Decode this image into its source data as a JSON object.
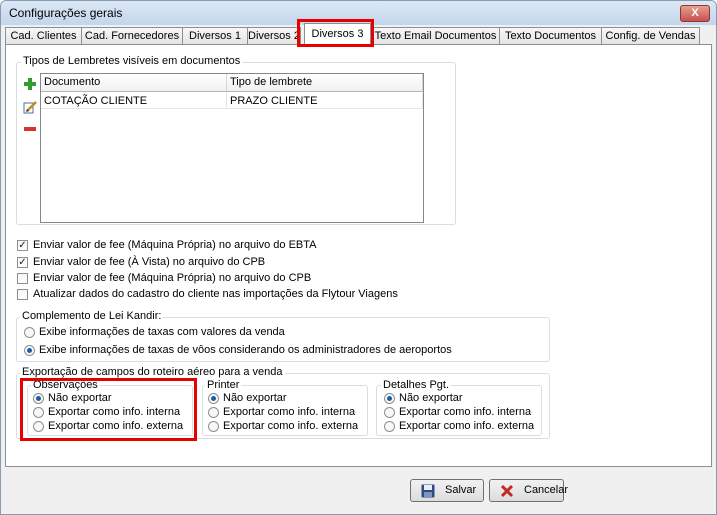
{
  "window": {
    "title": "Configurações gerais",
    "close_label": "X"
  },
  "tabs": [
    {
      "label": "Cad. Clientes"
    },
    {
      "label": "Cad. Fornecedores"
    },
    {
      "label": "Diversos 1"
    },
    {
      "label": "Diversos 2"
    },
    {
      "label": "Diversos 3",
      "active": true
    },
    {
      "label": "Texto Email Documentos"
    },
    {
      "label": "Texto Documentos"
    },
    {
      "label": "Config. de Vendas"
    }
  ],
  "reminders": {
    "group_label": "Tipos de Lembretes visíveis em documentos",
    "columns": [
      "Documento",
      "Tipo de lembrete"
    ],
    "rows": [
      {
        "documento": "COTAÇÃO CLIENTE",
        "tipo": "PRAZO CLIENTE"
      }
    ],
    "icons": [
      "add-icon",
      "edit-icon",
      "remove-icon"
    ]
  },
  "checkboxes": [
    {
      "label": "Enviar valor de fee (Máquina Própria) no arquivo do EBTA",
      "checked": true
    },
    {
      "label": "Enviar valor de fee (À Vista) no arquivo do CPB",
      "checked": true
    },
    {
      "label": "Enviar valor de fee (Máquina Própria) no arquivo do CPB",
      "checked": false
    },
    {
      "label": "Atualizar dados do cadastro do cliente nas importações da Flytour Viagens",
      "checked": false
    }
  ],
  "lei_kandir": {
    "group_label": "Complemento de Lei Kandir:",
    "options": [
      {
        "label": "Exibe informações de taxas com valores da venda",
        "selected": false
      },
      {
        "label": "Exibe informações de taxas de vôos considerando os administradores de aeroportos",
        "selected": true
      }
    ]
  },
  "export": {
    "group_label": "Exportação de campos do roteiro aéreo para a venda",
    "subgroups": [
      {
        "label": "Observações",
        "options": [
          {
            "label": "Não exportar",
            "selected": true
          },
          {
            "label": "Exportar como info. interna",
            "selected": false
          },
          {
            "label": "Exportar como info. externa",
            "selected": false
          }
        ]
      },
      {
        "label": "Printer",
        "options": [
          {
            "label": "Não exportar",
            "selected": true
          },
          {
            "label": "Exportar como info. interna",
            "selected": false
          },
          {
            "label": "Exportar como info. externa",
            "selected": false
          }
        ]
      },
      {
        "label": "Detalhes Pgt.",
        "options": [
          {
            "label": "Não exportar",
            "selected": true
          },
          {
            "label": "Exportar como info. interna",
            "selected": false
          },
          {
            "label": "Exportar como info. externa",
            "selected": false
          }
        ]
      }
    ]
  },
  "buttons": {
    "save_label": "Salvar",
    "cancel_label": "Cancelar"
  },
  "colors": {
    "highlight": "#e60000",
    "check_green": "#2e9e2e",
    "remove_red": "#d93030"
  }
}
